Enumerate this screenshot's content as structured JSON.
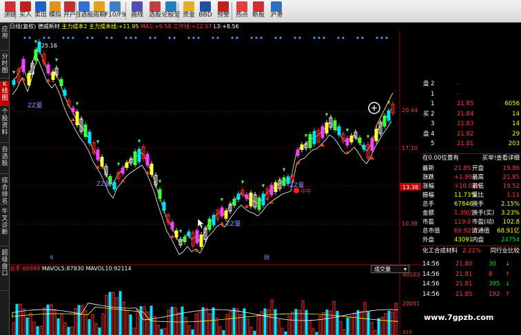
{
  "toolbar": {
    "items": [
      "测链",
      "买入",
      "卖出",
      "模拟",
      "开户",
      "自选股",
      "周期",
      "F10/F9",
      "画线",
      "选股",
      "论股堂",
      "资金",
      "BBD",
      "预警",
      "热点",
      "新股",
      "沪港"
    ]
  },
  "sidebar": {
    "items": [
      "应用",
      "分时图",
      "K线图",
      "个股资料",
      "自选股",
      "综合排名",
      "牛叉诊断",
      "超级盘口"
    ]
  },
  "info": {
    "kline": "日线(复权)",
    "indicator": "德威新材",
    "m1": "主力成本2",
    "m2": "主力成本线:",
    "m2v": "+11.95",
    "ma1": "MA1:",
    "ma1v": "+9.58",
    "gzx": "工作线:",
    "gzxv": "+12.07",
    "l3": "L3:",
    "l3v": "+8.56"
  },
  "chart": {
    "price_labels": [
      "20.44",
      "17.10",
      "13.38",
      "10.38"
    ],
    "high_label": "25.16",
    "low_label": "q",
    "fin_label": "财",
    "zz_labels": [
      "ZZ量",
      "ZZ量",
      "ZZ量",
      "ZZ量"
    ],
    "zhongniu": "中牛",
    "vol_scale": [
      "40103",
      "20051",
      "X10"
    ]
  },
  "volbar": {
    "name": "总手:",
    "val": "60989",
    "ma5": "MAVOL5:",
    "ma5v": "87830",
    "ma10": "MAVOL10:",
    "ma10v": "92114",
    "dd": "成交量"
  },
  "quote": {
    "sell": [
      {
        "l": "盘",
        "n": "2",
        "p": "-",
        "v": ""
      },
      {
        "l": "",
        "n": "1",
        "p": "-",
        "v": ""
      },
      {
        "l": "",
        "n": "1",
        "p": "21.85",
        "v": "6056"
      },
      {
        "l": "买",
        "n": "2",
        "p": "21.84",
        "v": "14"
      },
      {
        "l": "",
        "n": "3",
        "p": "21.83",
        "v": "14"
      },
      {
        "l": "盘",
        "n": "4",
        "p": "21.82",
        "v": "29"
      },
      {
        "l": "",
        "n": "5",
        "p": "21.81",
        "v": "203"
      }
    ],
    "pos": "在0.00位置有",
    "pos2": "买单!查看详细",
    "rows": [
      [
        "最新",
        "21.85",
        "开盘",
        "19.86"
      ],
      [
        "涨跌",
        "+1.99",
        "最高",
        "21.85"
      ],
      [
        "涨幅",
        "+10.02%",
        "最低",
        "19.52"
      ],
      [
        "振幅",
        "11.73%",
        "量比",
        "1.11"
      ],
      [
        "总手",
        "67846",
        "换手",
        "2.15%"
      ],
      [
        "金额",
        "1.39亿",
        "换手(实)",
        "3.23%"
      ],
      [
        "市盈",
        "119.0",
        "市盈(动)",
        "102.8"
      ],
      [
        "总市值",
        "69.92亿",
        "流通值",
        "68.91亿"
      ],
      [
        "外盘",
        "43091",
        "内盘",
        "24754"
      ]
    ],
    "industry": "化工合成材料",
    "industry_pct": "2.21%",
    "industry_btn": "同行业比较",
    "ticks": [
      [
        "14:56",
        "21.80",
        "30"
      ],
      [
        "14:56",
        "21.81",
        "8"
      ],
      [
        "14:56",
        "21.81",
        "395"
      ],
      [
        "14:56",
        "21.85",
        "192"
      ]
    ]
  },
  "watermark": "www.7gpzb.com",
  "colors": {
    "up": "#ff3c3c",
    "down": "#00d8ff",
    "accent": "#ffff00",
    "bg": "#000000"
  }
}
